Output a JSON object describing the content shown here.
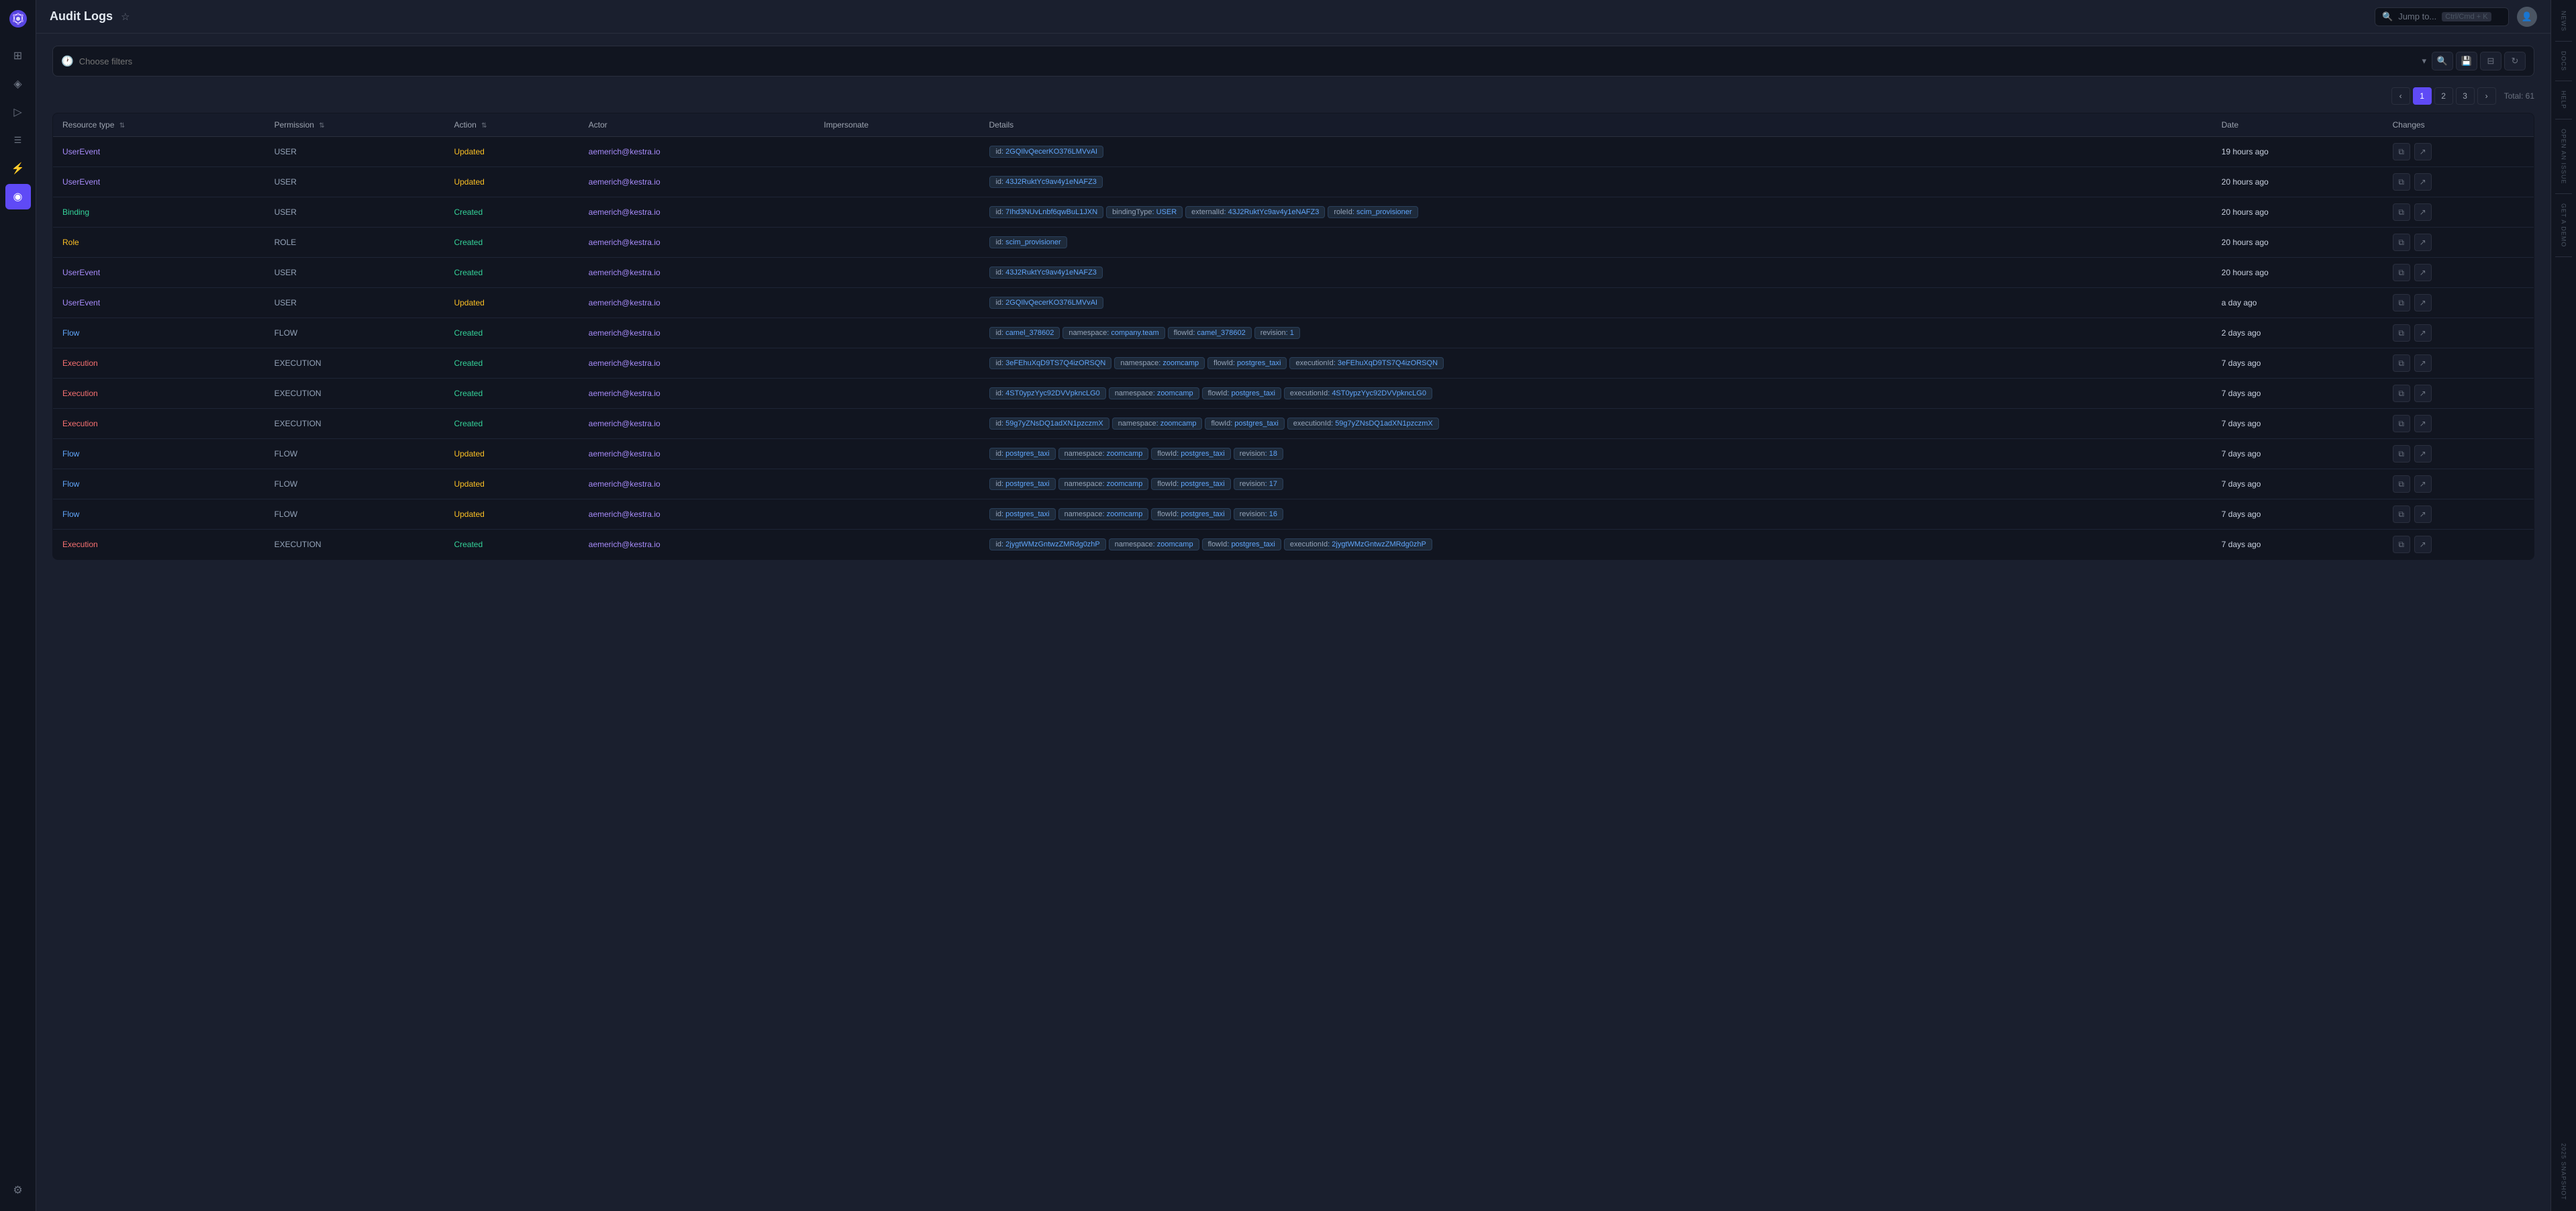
{
  "app": {
    "title": "Audit Logs"
  },
  "header": {
    "title": "Audit Logs",
    "search_placeholder": "Jump to...",
    "kbd_shortcut": "Ctrl/Cmd + K"
  },
  "filter": {
    "placeholder": "Choose filters",
    "total": "Total: 61"
  },
  "pagination": {
    "current": 1,
    "pages": [
      "1",
      "2",
      "3"
    ],
    "total_label": "Total: 61"
  },
  "table": {
    "columns": [
      {
        "id": "resource_type",
        "label": "Resource type",
        "sortable": true
      },
      {
        "id": "permission",
        "label": "Permission",
        "sortable": true
      },
      {
        "id": "action",
        "label": "Action",
        "sortable": true
      },
      {
        "id": "actor",
        "label": "Actor",
        "sortable": false
      },
      {
        "id": "impersonate",
        "label": "Impersonate",
        "sortable": false
      },
      {
        "id": "details",
        "label": "Details",
        "sortable": false
      },
      {
        "id": "date",
        "label": "Date",
        "sortable": false
      },
      {
        "id": "changes",
        "label": "Changes",
        "sortable": false
      }
    ],
    "rows": [
      {
        "resource_type": "UserEvent",
        "rt_class": "rt-userevent",
        "permission": "USER",
        "action": "Updated",
        "actor": "aemerich@kestra.io",
        "impersonate": "",
        "details": [
          {
            "key": "id",
            "val": "2GQIlvQecerKO376LMVvAI"
          }
        ],
        "date": "19 hours ago"
      },
      {
        "resource_type": "UserEvent",
        "rt_class": "rt-userevent",
        "permission": "USER",
        "action": "Updated",
        "actor": "aemerich@kestra.io",
        "impersonate": "",
        "details": [
          {
            "key": "id",
            "val": "43J2RuktYc9av4y1eNAFZ3"
          }
        ],
        "date": "20 hours ago"
      },
      {
        "resource_type": "Binding",
        "rt_class": "rt-binding",
        "permission": "USER",
        "action": "Created",
        "actor": "aemerich@kestra.io",
        "impersonate": "",
        "details": [
          {
            "key": "id",
            "val": "7Ihd3NUvLnbf6qwBuL1JXN"
          },
          {
            "key": "bindingType",
            "val": "USER"
          },
          {
            "key": "externalId",
            "val": "43J2RuktYc9av4y1eNAFZ3"
          },
          {
            "key": "roleId",
            "val": "scim_provisioner"
          }
        ],
        "date": "20 hours ago"
      },
      {
        "resource_type": "Role",
        "rt_class": "rt-role",
        "permission": "ROLE",
        "action": "Created",
        "actor": "aemerich@kestra.io",
        "impersonate": "",
        "details": [
          {
            "key": "id",
            "val": "scim_provisioner"
          }
        ],
        "date": "20 hours ago"
      },
      {
        "resource_type": "UserEvent",
        "rt_class": "rt-userevent",
        "permission": "USER",
        "action": "Created",
        "actor": "aemerich@kestra.io",
        "impersonate": "",
        "details": [
          {
            "key": "id",
            "val": "43J2RuktYc9av4y1eNAFZ3"
          }
        ],
        "date": "20 hours ago"
      },
      {
        "resource_type": "UserEvent",
        "rt_class": "rt-userevent",
        "permission": "USER",
        "action": "Updated",
        "actor": "aemerich@kestra.io",
        "impersonate": "",
        "details": [
          {
            "key": "id",
            "val": "2GQIlvQecerKO376LMVvAI"
          }
        ],
        "date": "a day ago"
      },
      {
        "resource_type": "Flow",
        "rt_class": "rt-flow",
        "permission": "FLOW",
        "action": "Created",
        "actor": "aemerich@kestra.io",
        "impersonate": "",
        "details": [
          {
            "key": "id",
            "val": "camel_378602"
          },
          {
            "key": "namespace",
            "val": "company.team"
          },
          {
            "key": "flowId",
            "val": "camel_378602"
          },
          {
            "key": "revision",
            "val": "1"
          }
        ],
        "date": "2 days ago"
      },
      {
        "resource_type": "Execution",
        "rt_class": "rt-execution",
        "permission": "EXECUTION",
        "action": "Created",
        "actor": "aemerich@kestra.io",
        "impersonate": "",
        "details": [
          {
            "key": "id",
            "val": "3eFEhuXqD9TS7Q4izORSQN"
          },
          {
            "key": "namespace",
            "val": "zoomcamp"
          },
          {
            "key": "flowId",
            "val": "postgres_taxi"
          },
          {
            "key": "executionId",
            "val": "3eFEhuXqD9TS7Q4izORSQN"
          }
        ],
        "date": "7 days ago"
      },
      {
        "resource_type": "Execution",
        "rt_class": "rt-execution",
        "permission": "EXECUTION",
        "action": "Created",
        "actor": "aemerich@kestra.io",
        "impersonate": "",
        "details": [
          {
            "key": "id",
            "val": "4ST0ypzYyc92DVVpkncLG0"
          },
          {
            "key": "namespace",
            "val": "zoomcamp"
          },
          {
            "key": "flowId",
            "val": "postgres_taxi"
          },
          {
            "key": "executionId",
            "val": "4ST0ypzYyc92DVVpkncLG0"
          }
        ],
        "date": "7 days ago"
      },
      {
        "resource_type": "Execution",
        "rt_class": "rt-execution",
        "permission": "EXECUTION",
        "action": "Created",
        "actor": "aemerich@kestra.io",
        "impersonate": "",
        "details": [
          {
            "key": "id",
            "val": "59g7yZNsDQ1adXN1pzczmX"
          },
          {
            "key": "namespace",
            "val": "zoomcamp"
          },
          {
            "key": "flowId",
            "val": "postgres_taxi"
          },
          {
            "key": "executionId",
            "val": "59g7yZNsDQ1adXN1pzczmX"
          }
        ],
        "date": "7 days ago"
      },
      {
        "resource_type": "Flow",
        "rt_class": "rt-flow",
        "permission": "FLOW",
        "action": "Updated",
        "actor": "aemerich@kestra.io",
        "impersonate": "",
        "details": [
          {
            "key": "id",
            "val": "postgres_taxi"
          },
          {
            "key": "namespace",
            "val": "zoomcamp"
          },
          {
            "key": "flowId",
            "val": "postgres_taxi"
          },
          {
            "key": "revision",
            "val": "18"
          }
        ],
        "date": "7 days ago"
      },
      {
        "resource_type": "Flow",
        "rt_class": "rt-flow",
        "permission": "FLOW",
        "action": "Updated",
        "actor": "aemerich@kestra.io",
        "impersonate": "",
        "details": [
          {
            "key": "id",
            "val": "postgres_taxi"
          },
          {
            "key": "namespace",
            "val": "zoomcamp"
          },
          {
            "key": "flowId",
            "val": "postgres_taxi"
          },
          {
            "key": "revision",
            "val": "17"
          }
        ],
        "date": "7 days ago"
      },
      {
        "resource_type": "Flow",
        "rt_class": "rt-flow",
        "permission": "FLOW",
        "action": "Updated",
        "actor": "aemerich@kestra.io",
        "impersonate": "",
        "details": [
          {
            "key": "id",
            "val": "postgres_taxi"
          },
          {
            "key": "namespace",
            "val": "zoomcamp"
          },
          {
            "key": "flowId",
            "val": "postgres_taxi"
          },
          {
            "key": "revision",
            "val": "16"
          }
        ],
        "date": "7 days ago"
      },
      {
        "resource_type": "Execution",
        "rt_class": "rt-execution",
        "permission": "EXECUTION",
        "action": "Created",
        "actor": "aemerich@kestra.io",
        "impersonate": "",
        "details": [
          {
            "key": "id",
            "val": "2jygtWMzGntwzZMRdg0zhP"
          },
          {
            "key": "namespace",
            "val": "zoomcamp"
          },
          {
            "key": "flowId",
            "val": "postgres_taxi"
          },
          {
            "key": "executionId",
            "val": "2jygtWMzGntwzZMRdg0zhP"
          }
        ],
        "date": "7 days ago"
      }
    ]
  },
  "left_nav": {
    "items": [
      {
        "id": "dashboard",
        "icon": "⊞",
        "label": "Dashboard"
      },
      {
        "id": "flows",
        "icon": "◈",
        "label": "Flows"
      },
      {
        "id": "executions",
        "icon": "▶",
        "label": "Executions"
      },
      {
        "id": "logs",
        "icon": "☰",
        "label": "Logs"
      },
      {
        "id": "plugins",
        "icon": "⚡",
        "label": "Plugins"
      },
      {
        "id": "audit",
        "icon": "◉",
        "label": "Audit",
        "active": true
      },
      {
        "id": "settings",
        "icon": "⚙",
        "label": "Settings"
      }
    ]
  },
  "right_sidebar": {
    "sections": [
      {
        "label": "News"
      },
      {
        "label": "Docs"
      },
      {
        "label": "Help"
      },
      {
        "label": "Open an Issue"
      },
      {
        "label": "Get a demo"
      },
      {
        "label": "2025 SNAPSHOT"
      }
    ]
  }
}
